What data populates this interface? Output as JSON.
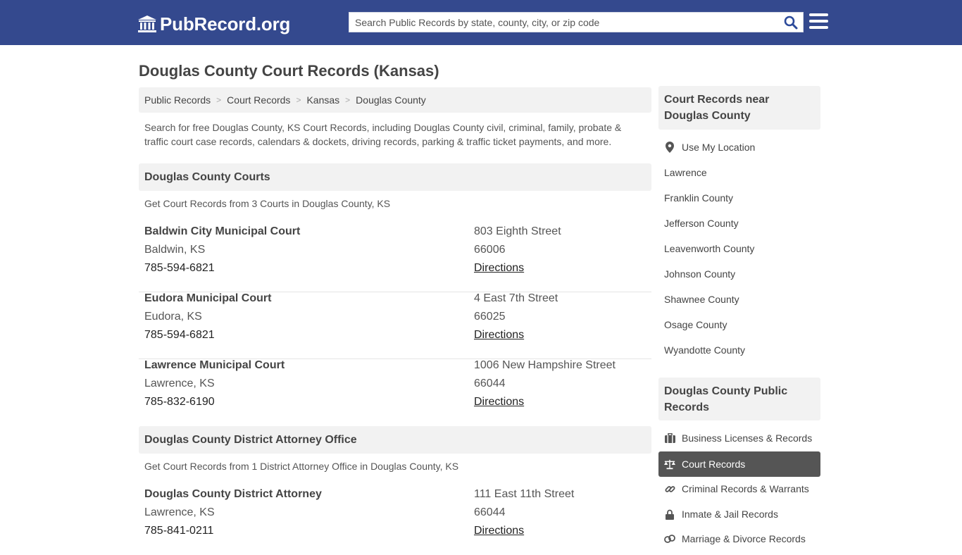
{
  "header": {
    "logo_text": "PubRecord.org",
    "search_placeholder": "Search Public Records by state, county, city, or zip code",
    "colors": {
      "bar": "#34498e",
      "search_icon": "#2b4a9a"
    }
  },
  "page": {
    "title": "Douglas County Court Records (Kansas)",
    "breadcrumb": [
      "Public Records",
      "Court Records",
      "Kansas",
      "Douglas County"
    ],
    "intro": "Search for free Douglas County, KS Court Records, including Douglas County civil, criminal, family, probate & traffic court case records, calendars & dockets, driving records, parking & traffic ticket payments, and more."
  },
  "courts_section": {
    "heading": "Douglas County Courts",
    "subtitle": "Get Court Records from 3 Courts in Douglas County, KS",
    "items": [
      {
        "name": "Baldwin City Municipal Court",
        "city": "Baldwin, KS",
        "phone": "785-594-6821",
        "street": "803 Eighth Street",
        "zip": "66006",
        "directions": "Directions"
      },
      {
        "name": "Eudora Municipal Court",
        "city": "Eudora, KS",
        "phone": "785-594-6821",
        "street": "4 East 7th Street",
        "zip": "66025",
        "directions": "Directions"
      },
      {
        "name": "Lawrence Municipal Court",
        "city": "Lawrence, KS",
        "phone": "785-832-6190",
        "street": "1006 New Hampshire Street",
        "zip": "66044",
        "directions": "Directions"
      }
    ]
  },
  "da_section": {
    "heading": "Douglas County District Attorney Office",
    "subtitle": "Get Court Records from 1 District Attorney Office in Douglas County, KS",
    "items": [
      {
        "name": "Douglas County District Attorney",
        "city": "Lawrence, KS",
        "phone": "785-841-0211",
        "street": "111 East 11th Street",
        "zip": "66044",
        "directions": "Directions"
      }
    ]
  },
  "sidebar": {
    "nearby_heading": "Court Records near Douglas County",
    "use_location": "Use My Location",
    "nearby": [
      "Lawrence",
      "Franklin County",
      "Jefferson County",
      "Leavenworth County",
      "Johnson County",
      "Shawnee County",
      "Osage County",
      "Wyandotte County"
    ],
    "public_heading": "Douglas County Public Records",
    "categories": [
      {
        "label": "Business Licenses & Records",
        "icon": "briefcase-icon"
      },
      {
        "label": "Court Records",
        "icon": "scales-icon",
        "active": true
      },
      {
        "label": "Criminal Records & Warrants",
        "icon": "link-icon"
      },
      {
        "label": "Inmate & Jail Records",
        "icon": "lock-icon"
      },
      {
        "label": "Marriage & Divorce Records",
        "icon": "rings-icon"
      }
    ]
  }
}
